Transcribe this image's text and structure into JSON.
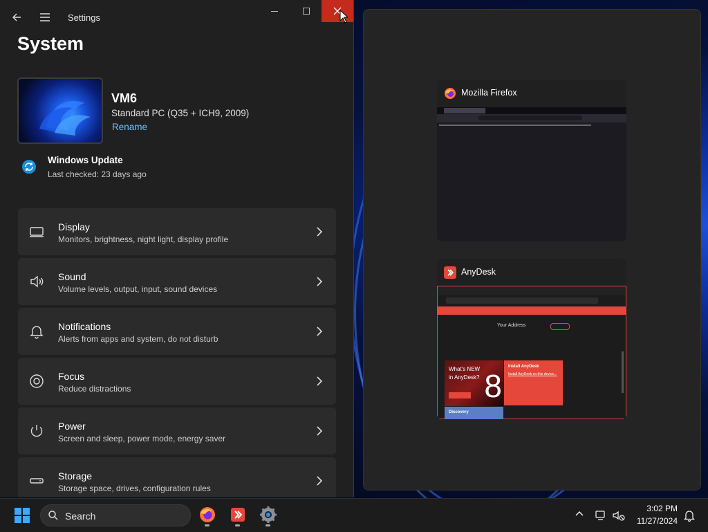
{
  "settings": {
    "window_title": "Settings",
    "page_title": "System",
    "device": {
      "name": "VM6",
      "model": "Standard PC (Q35 + ICH9, 2009)",
      "rename_label": "Rename"
    },
    "windows_update": {
      "title": "Windows Update",
      "status": "Last checked: 23 days ago"
    },
    "categories": [
      {
        "title": "Display",
        "subtitle": "Monitors, brightness, night light, display profile",
        "icon": "monitor-icon"
      },
      {
        "title": "Sound",
        "subtitle": "Volume levels, output, input, sound devices",
        "icon": "speaker-icon"
      },
      {
        "title": "Notifications",
        "subtitle": "Alerts from apps and system, do not disturb",
        "icon": "bell-icon"
      },
      {
        "title": "Focus",
        "subtitle": "Reduce distractions",
        "icon": "focus-icon"
      },
      {
        "title": "Power",
        "subtitle": "Screen and sleep, power mode, energy saver",
        "icon": "power-icon"
      },
      {
        "title": "Storage",
        "subtitle": "Storage space, drives, configuration rules",
        "icon": "storage-icon"
      }
    ]
  },
  "task_view": {
    "windows": [
      {
        "title": "Mozilla Firefox",
        "icon": "firefox-icon"
      },
      {
        "title": "AnyDesk",
        "icon": "anydesk-icon",
        "preview": {
          "your_address_label": "Your Address",
          "tile_new_line1": "What's NEW",
          "tile_new_line2": "in AnyDesk?",
          "tile_new_number": "8",
          "tile_install_title": "Install AnyDesk",
          "tile_install_link": "Install AnyDesk on this device...",
          "tile_discovery": "Discovery"
        }
      }
    ]
  },
  "taskbar": {
    "search_placeholder": "Search",
    "pinned": [
      "firefox-icon",
      "anydesk-icon",
      "settings-icon"
    ],
    "clock_time": "3:02 PM",
    "clock_date": "11/27/2024"
  },
  "colors": {
    "close_red": "#c42b1c",
    "link_blue": "#6bc3ff",
    "anydesk_red": "#e5473a",
    "start_blue": "#3ea8ff"
  }
}
